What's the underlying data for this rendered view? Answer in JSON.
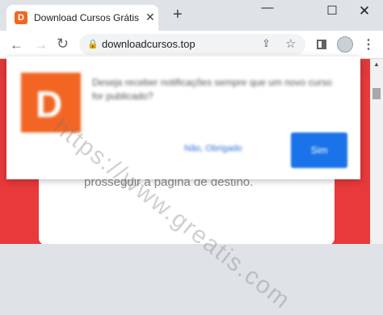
{
  "tab": {
    "favicon_letter": "D",
    "title": "Download Cursos Grátis - Baixe n",
    "close": "✕"
  },
  "newtab": "+",
  "window": {
    "chevron": "⌄",
    "minimize": "—",
    "maximize": "☐",
    "close": "✕"
  },
  "toolbar": {
    "back": "←",
    "forward": "→",
    "reload": "↻"
  },
  "omnibox": {
    "url": "downloadcursos.top",
    "lock": "🔒",
    "share": "⇪",
    "star": "☆"
  },
  "menu": "⋮",
  "page": {
    "card_text": "prosseguir à página de destino."
  },
  "prompt": {
    "logo_letter": "D",
    "message": "Deseja receber notificações sempre que um novo curso for publicado?",
    "later_label": "Não, Obrigado",
    "yes_label": "Sim"
  },
  "watermark": "https://www.greatis.com",
  "colors": {
    "brand": "#f26522",
    "page_red": "#e8393b",
    "button_blue": "#1a73e8"
  }
}
